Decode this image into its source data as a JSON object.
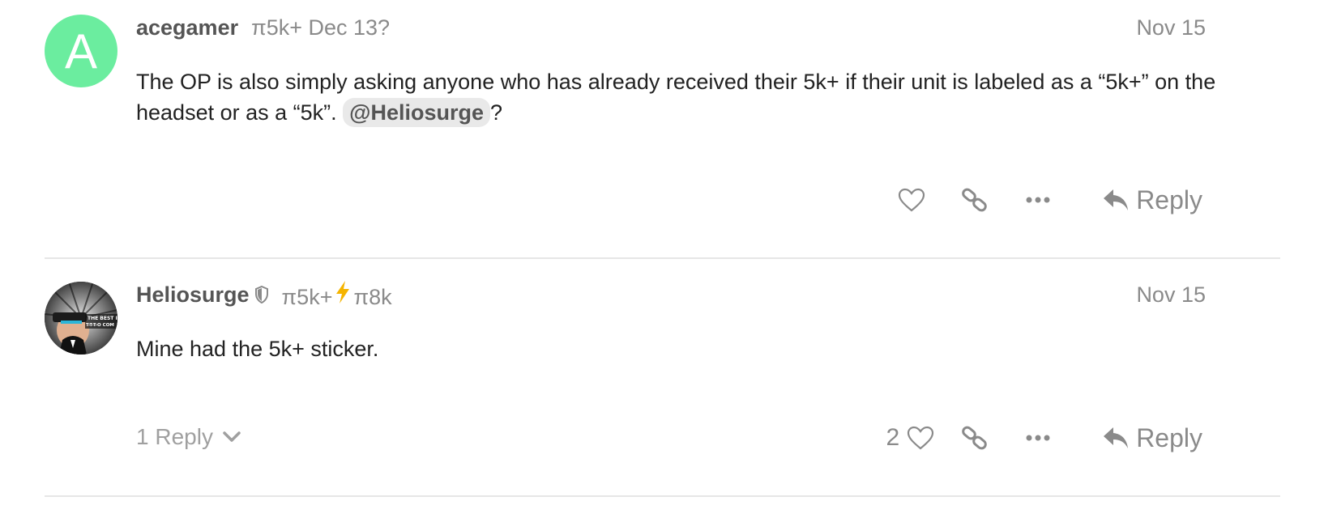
{
  "posts": [
    {
      "username": "acegamer",
      "flair": "π5k+ Dec 13?",
      "avatar_letter": "A",
      "avatar_color": "#6bed9f",
      "date": "Nov 15",
      "body_before": "The OP is also simply asking anyone who has already received their 5k+ if their unit is labeled as a “5k+” on the headset or as a “5k”. ",
      "mention": "@Heliosurge",
      "body_after": "?",
      "reply_label": "Reply"
    },
    {
      "username": "Heliosurge",
      "flair_a": "π5k+",
      "flair_b": "π8k",
      "avatar_text": "THE BEST IS T-T-T-O COM",
      "date": "Nov 15",
      "body": "Mine had the 5k+ sticker.",
      "replies_label": "1 Reply",
      "like_count": "2",
      "reply_label": "Reply"
    }
  ],
  "icons": {
    "like": "heart-icon",
    "link": "link-icon",
    "more": "ellipsis-icon",
    "reply": "reply-arrow-icon",
    "moderator": "shield-icon",
    "flair_bolt": "lightning-bolt-icon",
    "expand": "chevron-down-icon"
  },
  "colors": {
    "muted": "#8a8a8a",
    "accent_bolt": "#f5b400",
    "mention_bg": "#e9e9e9"
  }
}
